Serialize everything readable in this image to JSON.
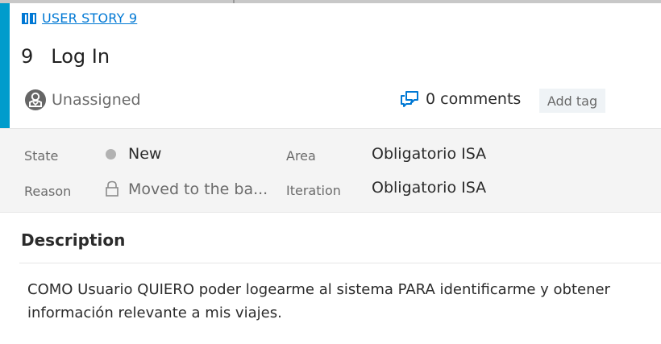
{
  "work_item": {
    "type_label": "USER STORY 9",
    "id": "9",
    "title": "Log In"
  },
  "header": {
    "assignee": "Unassigned",
    "comments_label": "0 comments",
    "add_tag_label": "Add tag"
  },
  "fields": {
    "state_label": "State",
    "state_value": "New",
    "reason_label": "Reason",
    "reason_value": "Moved to the ba...",
    "area_label": "Area",
    "area_value": "Obligatorio ISA",
    "iteration_label": "Iteration",
    "iteration_value": "Obligatorio ISA"
  },
  "description": {
    "heading": "Description",
    "text": "COMO Usuario QUIERO poder logearme al sistema PARA identificarme y obtener información relevante a mis viajes."
  },
  "icons": {
    "work_item_type": "book-icon",
    "avatar": "unassigned-avatar-icon",
    "comments": "comments-icon",
    "state": "state-dot-icon",
    "reason": "lock-icon"
  },
  "colors": {
    "accent": "#009ccc",
    "link": "#0078d4",
    "state_new": "#b2b2b2"
  }
}
